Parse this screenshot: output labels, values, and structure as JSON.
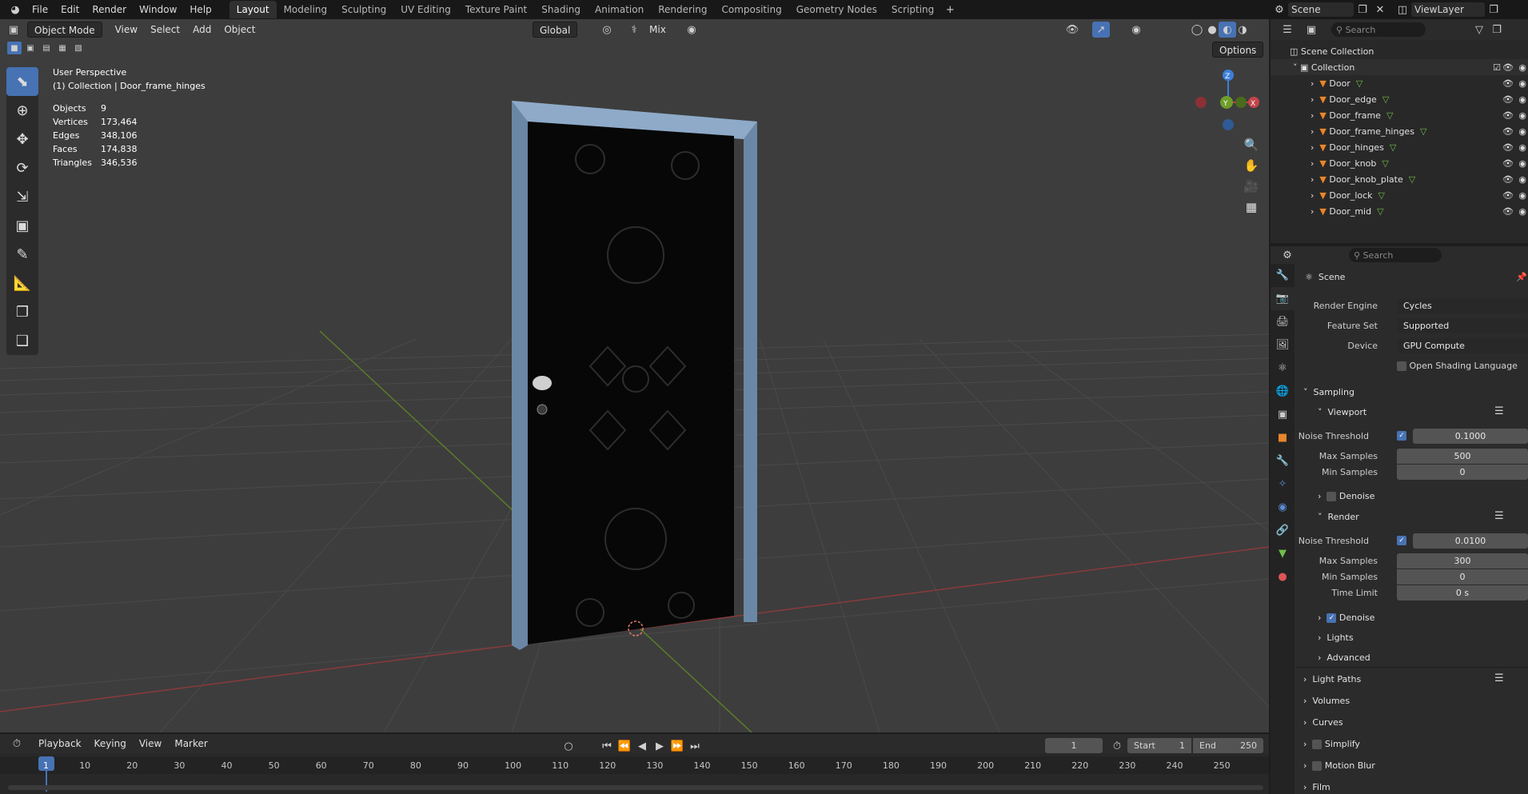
{
  "topbar": {
    "menus": [
      "File",
      "Edit",
      "Render",
      "Window",
      "Help"
    ],
    "workspaces": [
      "Layout",
      "Modeling",
      "Sculpting",
      "UV Editing",
      "Texture Paint",
      "Shading",
      "Animation",
      "Rendering",
      "Compositing",
      "Geometry Nodes",
      "Scripting"
    ],
    "active_workspace": "Layout",
    "scene": "Scene",
    "view_layer": "ViewLayer"
  },
  "viewport": {
    "mode": "Object Mode",
    "menus": [
      "View",
      "Select",
      "Add",
      "Object"
    ],
    "transform": "Global",
    "snap": "Mix",
    "options": "Options",
    "view_name": "User Perspective",
    "context": "(1) Collection | Door_frame_hinges",
    "stats": [
      {
        "k": "Objects",
        "v": "9"
      },
      {
        "k": "Vertices",
        "v": "173,464"
      },
      {
        "k": "Edges",
        "v": "348,106"
      },
      {
        "k": "Faces",
        "v": "174,838"
      },
      {
        "k": "Triangles",
        "v": "346,536"
      }
    ],
    "gizmo": {
      "z": "Z",
      "y": "Y",
      "x": "X"
    }
  },
  "outliner": {
    "search_placeholder": "Search",
    "root": "Scene Collection",
    "collection": "Collection",
    "objects": [
      "Door",
      "Door_edge",
      "Door_frame",
      "Door_frame_hinges",
      "Door_hinges",
      "Door_knob",
      "Door_knob_plate",
      "Door_lock",
      "Door_mid"
    ]
  },
  "properties": {
    "search_placeholder": "Search",
    "context": "Scene",
    "render_engine_label": "Render Engine",
    "render_engine": "Cycles",
    "feature_set_label": "Feature Set",
    "feature_set": "Supported",
    "device_label": "Device",
    "device": "GPU Compute",
    "osl": "Open Shading Language",
    "sampling": "Sampling",
    "viewport": "Viewport",
    "noise_threshold_label": "Noise Threshold",
    "vp_noise": "0.1000",
    "max_samples_label": "Max Samples",
    "vp_max": "500",
    "min_samples_label": "Min Samples",
    "vp_min": "0",
    "denoise": "Denoise",
    "render": "Render",
    "r_noise": "0.0100",
    "r_max": "300",
    "r_min": "0",
    "time_limit_label": "Time Limit",
    "time_limit": "0 s",
    "lights": "Lights",
    "advanced": "Advanced",
    "light_paths": "Light Paths",
    "volumes": "Volumes",
    "curves": "Curves",
    "simplify": "Simplify",
    "motion_blur": "Motion Blur",
    "film": "Film"
  },
  "timeline": {
    "menus": [
      "Playback",
      "Keying",
      "View",
      "Marker"
    ],
    "current_frame": "1",
    "start_label": "Start",
    "start": "1",
    "end_label": "End",
    "end": "250",
    "ticks": [
      "1",
      "10",
      "20",
      "30",
      "40",
      "50",
      "60",
      "70",
      "80",
      "90",
      "100",
      "110",
      "120",
      "130",
      "140",
      "150",
      "160",
      "170",
      "180",
      "190",
      "200",
      "210",
      "220",
      "230",
      "240",
      "250"
    ]
  },
  "colors": {
    "accent": "#4772b3",
    "x_axis": "#c2454a",
    "y_axis": "#6f9d2a",
    "z_axis": "#3d7fd8",
    "frame": "#6b8aab"
  }
}
